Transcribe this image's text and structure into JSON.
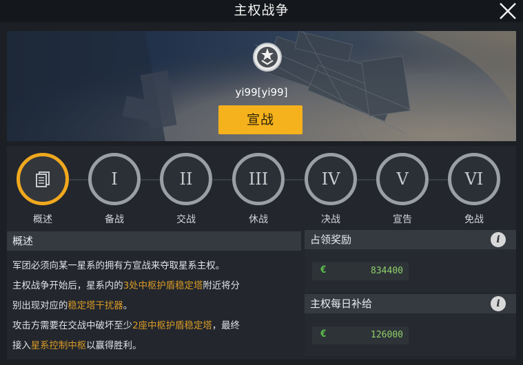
{
  "window": {
    "title": "主权战争"
  },
  "banner": {
    "player_name": "yi99[yi99]",
    "declare_label": "宣战"
  },
  "phases": [
    {
      "label": "概述",
      "numeral": "",
      "icon": "document-icon",
      "active": true
    },
    {
      "label": "备战",
      "numeral": "I",
      "active": false
    },
    {
      "label": "交战",
      "numeral": "II",
      "active": false
    },
    {
      "label": "休战",
      "numeral": "III",
      "active": false
    },
    {
      "label": "决战",
      "numeral": "IV",
      "active": false
    },
    {
      "label": "宣告",
      "numeral": "V",
      "active": false
    },
    {
      "label": "免战",
      "numeral": "VI",
      "active": false
    }
  ],
  "overview": {
    "heading": "概述",
    "line1": "军团必须向某一星系的拥有方宣战来夺取星系主权。",
    "line2_a": "主权战争开始后，星系内的",
    "line2_hl": "3处中枢护盾稳定塔",
    "line2_b": "附近将分",
    "line3_a": "别出现对应的",
    "line3_hl": "稳定塔干扰器",
    "line3_b": "。",
    "line4_a": "攻击方需要在交战中破坏至少",
    "line4_hl": "2座中枢护盾稳定塔",
    "line4_b": "，最终",
    "line5_a": "接入",
    "line5_hl": "星系控制中枢",
    "line5_b": "以赢得胜利。"
  },
  "reward": {
    "heading": "占领奖励",
    "info": "i",
    "currency_symbol": "€",
    "value": "834400"
  },
  "supply": {
    "heading": "主权每日补给",
    "info": "i",
    "currency_symbol": "€",
    "value": "126000"
  },
  "colors": {
    "accent": "#f5b21c",
    "highlight_text": "#d99a26",
    "value_green": "#8fd06a",
    "active_ring": "#f0a81e"
  }
}
